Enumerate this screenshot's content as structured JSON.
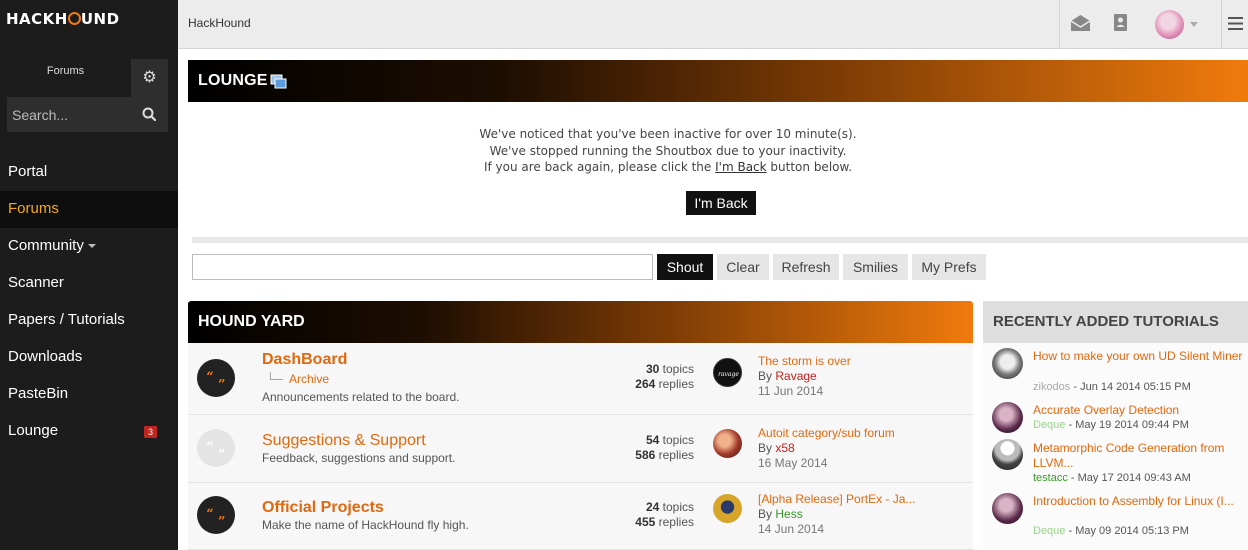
{
  "sidebar": {
    "logo_left": "HACKH",
    "logo_right": "UND",
    "tab_label": "Forums",
    "search_placeholder": "Search...",
    "nav": [
      {
        "label": "Portal"
      },
      {
        "label": "Forums"
      },
      {
        "label": "Community"
      },
      {
        "label": "Scanner"
      },
      {
        "label": "Papers / Tutorials"
      },
      {
        "label": "Downloads"
      },
      {
        "label": "PasteBin"
      },
      {
        "label": "Lounge",
        "badge": "3"
      }
    ]
  },
  "topbar": {
    "title": "HackHound"
  },
  "lounge": {
    "title": "LOUNGE",
    "msg_line1": "We've noticed that you've been inactive for over 10 minute(s).",
    "msg_line2": "We've stopped running the Shoutbox due to your inactivity.",
    "msg_line3_pre": "If you are back again, please click the ",
    "msg_line3_link": "I'm Back",
    "msg_line3_post": " button below.",
    "im_back_label": "I'm Back",
    "shout_label": "Shout",
    "clear_label": "Clear",
    "refresh_label": "Refresh",
    "smilies_label": "Smilies",
    "prefs_label": "My Prefs"
  },
  "yard": {
    "title": "HOUND YARD",
    "forums": [
      {
        "title": "DashBoard",
        "sub": "Archive",
        "desc": "Announcements related to the board.",
        "topics": "30",
        "topics_label": "topics",
        "replies": "264",
        "replies_label": "replies",
        "last_title": "The storm is over",
        "last_by_label": "By",
        "last_user": "Ravage",
        "last_date": "11 Jun 2014"
      },
      {
        "title": "Suggestions & Support",
        "desc": "Feedback, suggestions and support.",
        "topics": "54",
        "topics_label": "topics",
        "replies": "586",
        "replies_label": "replies",
        "last_title": "Autoit category/sub forum",
        "last_by_label": "By",
        "last_user": "x58",
        "last_date": "16 May 2014"
      },
      {
        "title": "Official Projects",
        "desc": "Make the name of HackHound fly high.",
        "topics": "24",
        "topics_label": "topics",
        "replies": "455",
        "replies_label": "replies",
        "last_title": "[Alpha Release] PortEx - Ja...",
        "last_by_label": "By",
        "last_user": "Hess",
        "last_date": "14 Jun 2014"
      }
    ]
  },
  "tutorials": {
    "title": "RECENTLY ADDED TUTORIALS",
    "items": [
      {
        "title": "How to make your own UD Silent Miner",
        "user": "zikodos",
        "date": " - Jun 14 2014 05:15 PM"
      },
      {
        "title": "Accurate Overlay Detection",
        "user": "Deque",
        "date": " - May 19 2014 09:44 PM"
      },
      {
        "title": "Metamorphic Code Generation from LLVM...",
        "user": "testacc",
        "date": " - May 17 2014 09:43 AM"
      },
      {
        "title": "Introduction to Assembly for Linux (I...",
        "user": "Deque",
        "date": " - May 09 2014 05:13 PM"
      }
    ]
  },
  "colors": {
    "accent": "#f07a10",
    "link": "#e0690f",
    "sidebar_bg": "#1c1c1c",
    "active_nav": "#f3a81c",
    "badge": "#c0251f"
  },
  "icons": {
    "settings": "gear-icon",
    "search": "search-icon",
    "mail": "envelope-icon",
    "contacts": "contact-card-icon",
    "menu": "hamburger-icon",
    "lounge": "windows-icon",
    "forum": "quote-icon"
  }
}
